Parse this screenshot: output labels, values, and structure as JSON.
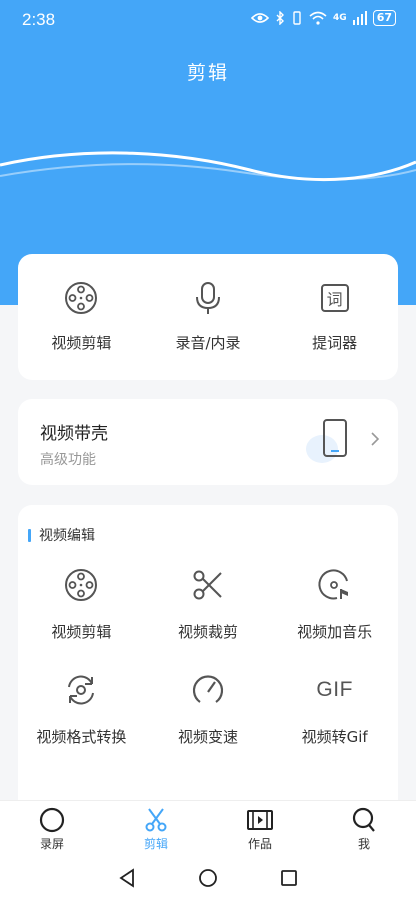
{
  "status": {
    "time": "2:38",
    "signal": "4G",
    "battery": "67"
  },
  "header": {
    "title": "剪辑"
  },
  "tools": [
    {
      "label": "视频剪辑",
      "icon": "film-reel-icon"
    },
    {
      "label": "录音/内录",
      "icon": "microphone-icon"
    },
    {
      "label": "提词器",
      "icon": "prompter-icon",
      "glyph": "词"
    }
  ],
  "promo": {
    "title": "视频带壳",
    "subtitle": "高级功能"
  },
  "section": {
    "title": "视频编辑"
  },
  "edit_items": [
    {
      "label": "视频剪辑",
      "icon": "film-reel-icon"
    },
    {
      "label": "视频裁剪",
      "icon": "scissors-icon"
    },
    {
      "label": "视频加音乐",
      "icon": "music-disc-icon"
    },
    {
      "label": "视频格式转换",
      "icon": "convert-icon"
    },
    {
      "label": "视频变速",
      "icon": "speedometer-icon"
    },
    {
      "label": "视频转Gif",
      "icon": "gif-icon",
      "glyph": "GIF"
    }
  ],
  "tabs": [
    {
      "label": "录屏",
      "icon": "record-circle-icon"
    },
    {
      "label": "剪辑",
      "icon": "scissors-icon"
    },
    {
      "label": "作品",
      "icon": "film-strip-icon"
    },
    {
      "label": "我",
      "icon": "user-icon"
    }
  ],
  "colors": {
    "accent": "#44a6f8",
    "background": "#f5f6f8"
  }
}
